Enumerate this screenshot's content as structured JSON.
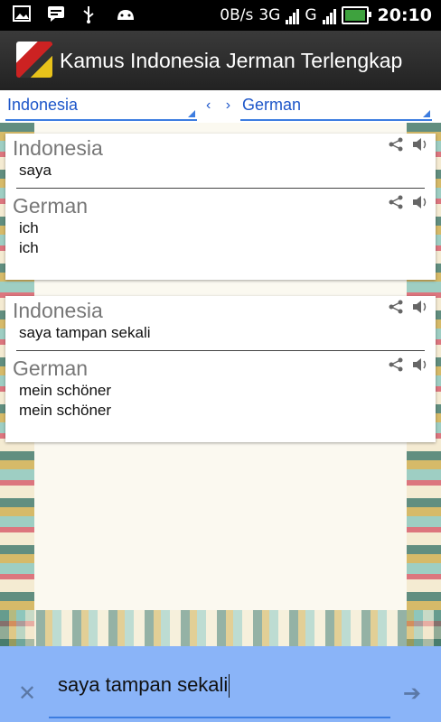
{
  "status_bar": {
    "net_speed": "0B/s",
    "network_3g": "3G",
    "network_g": "G",
    "time": "20:10",
    "icons": [
      "image-icon",
      "chat-icon",
      "usb-icon",
      "android-icon",
      "signal-icon",
      "battery-icon"
    ]
  },
  "app": {
    "title": "Kamus Indonesia Jerman Terlengkap"
  },
  "language_bar": {
    "source": "Indonesia",
    "swap": "‹ ›",
    "target": "German"
  },
  "results": [
    {
      "source_label": "Indonesia",
      "source_text": "saya",
      "target_label": "German",
      "target_lines": [
        "ich",
        "ich"
      ]
    },
    {
      "source_label": "Indonesia",
      "source_text": "saya tampan sekali",
      "target_label": "German",
      "target_lines": [
        "mein schöner",
        "mein schöner"
      ]
    }
  ],
  "input": {
    "value": "saya tampan sekali"
  },
  "colors": {
    "accent": "#3d7de0",
    "input_bar": "#8ab4f8",
    "title_bar": "#2a2a2a"
  }
}
